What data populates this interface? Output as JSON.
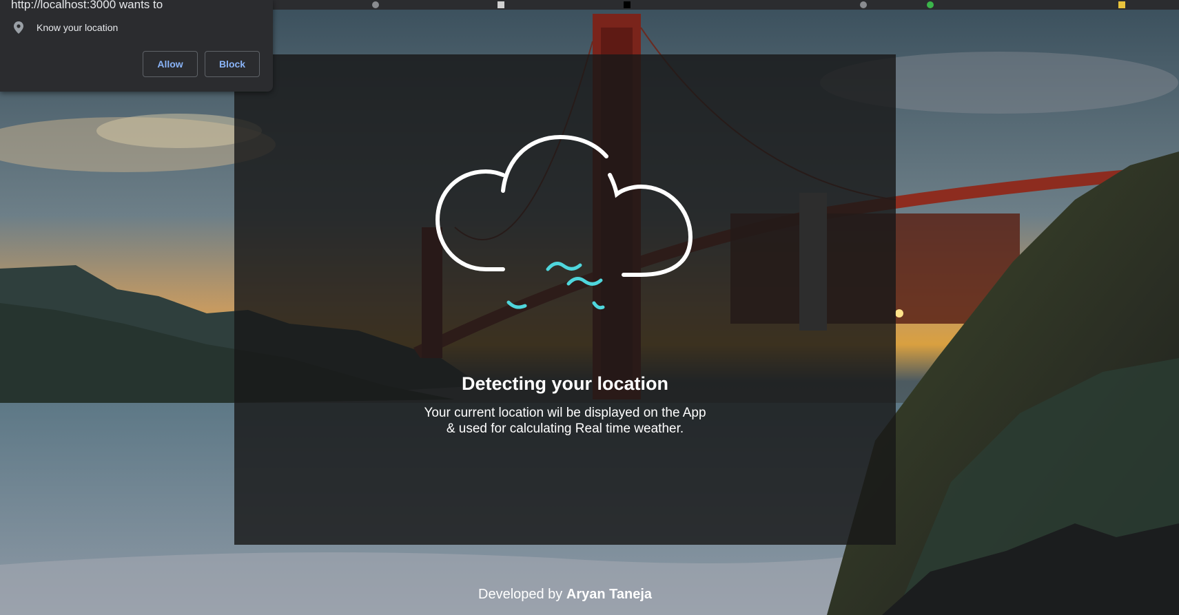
{
  "permission_prompt": {
    "title": "http://localhost:3000 wants to",
    "request_label": "Know your location",
    "request_icon": "location-pin-icon",
    "allow_label": "Allow",
    "block_label": "Block",
    "button_text_color": "#8ab4f8"
  },
  "loader": {
    "icon": "cloud-wind-icon",
    "heading": "Detecting your location",
    "description_line1": "Your current location wil be displayed on the App",
    "description_line2": "& used for calculating Real time weather.",
    "wind_color": "#4fd6dc"
  },
  "footer": {
    "prefix": "Developed by",
    "author": "Aryan Taneja"
  }
}
